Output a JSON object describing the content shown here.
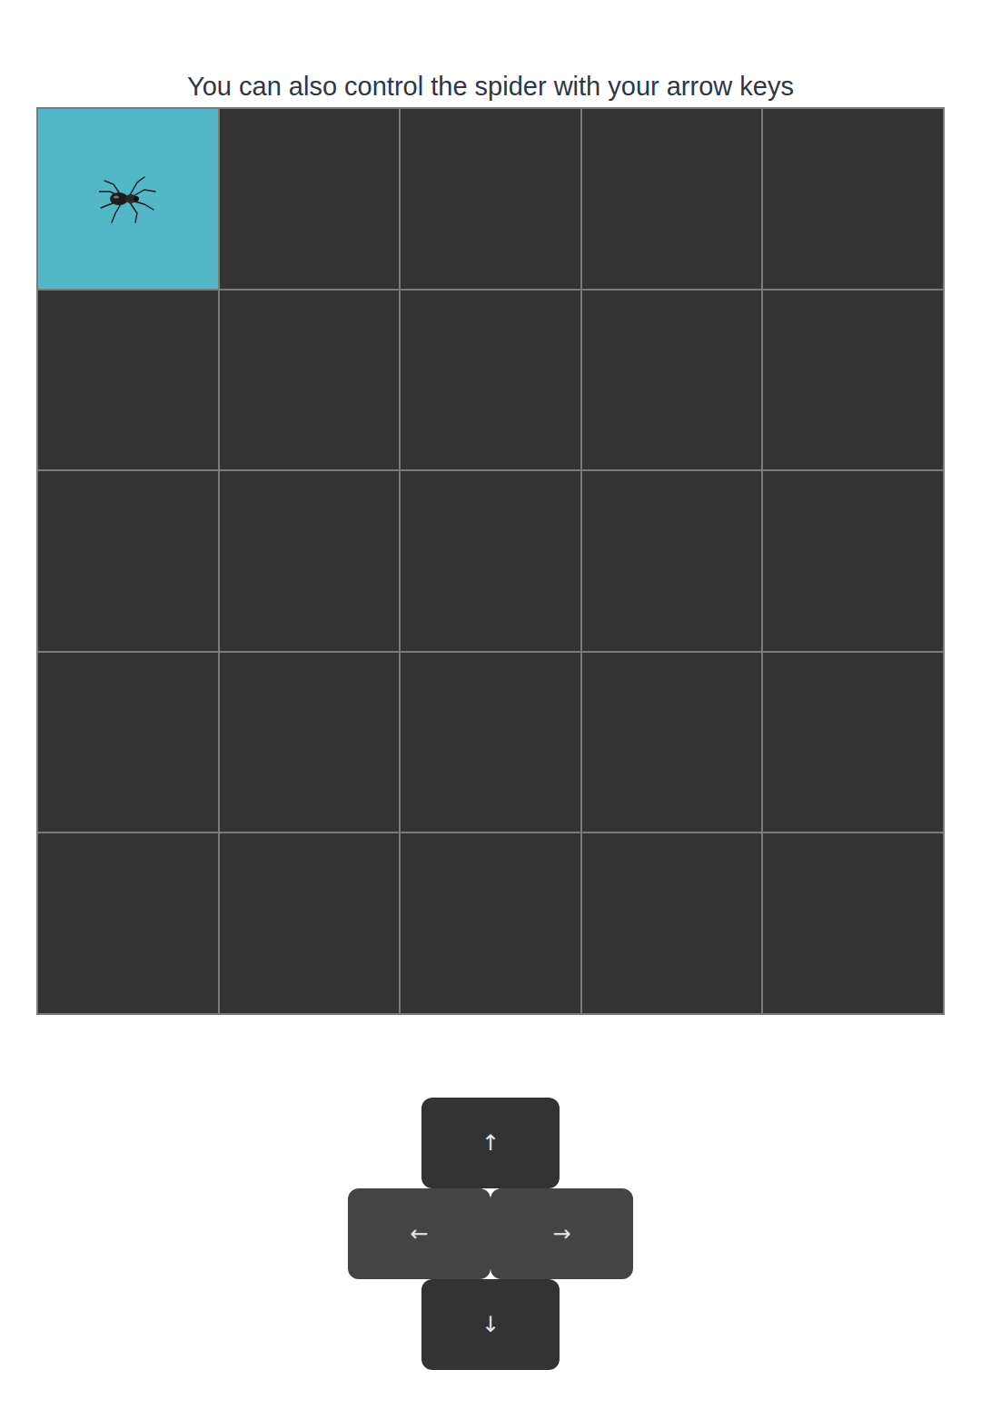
{
  "instruction": "You can also control the spider with your arrow keys",
  "grid": {
    "rows": [
      {
        "cells": [
          {
            "selected": true
          },
          {
            "selected": false
          },
          {
            "selected": false
          },
          {
            "selected": false
          },
          {
            "selected": false
          }
        ]
      },
      {
        "cells": [
          {
            "selected": false
          },
          {
            "selected": false
          },
          {
            "selected": false
          },
          {
            "selected": false
          },
          {
            "selected": false
          }
        ]
      },
      {
        "cells": [
          {
            "selected": false
          },
          {
            "selected": false
          },
          {
            "selected": false
          },
          {
            "selected": false
          },
          {
            "selected": false
          }
        ]
      },
      {
        "cells": [
          {
            "selected": false
          },
          {
            "selected": false
          },
          {
            "selected": false
          },
          {
            "selected": false
          },
          {
            "selected": false
          }
        ]
      },
      {
        "cells": [
          {
            "selected": false
          },
          {
            "selected": false
          },
          {
            "selected": false
          },
          {
            "selected": false
          },
          {
            "selected": false
          }
        ]
      }
    ]
  },
  "controls": {
    "rows": [
      {
        "keys": [
          {
            "label": "↑",
            "kind": "vertical"
          }
        ]
      },
      {
        "keys": [
          {
            "label": "←",
            "kind": "horizontal"
          },
          {
            "label": "→",
            "kind": "horizontal"
          }
        ]
      },
      {
        "keys": [
          {
            "label": "↓",
            "kind": "vertical"
          }
        ]
      }
    ]
  }
}
